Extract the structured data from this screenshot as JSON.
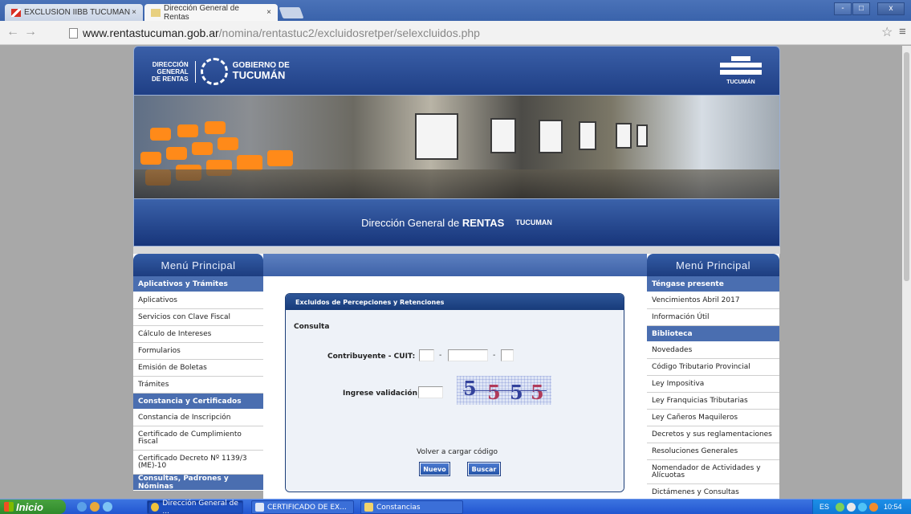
{
  "browser": {
    "tabs": [
      {
        "title": "EXCLUSION IIBB TUCUMAN",
        "icon": "gmail-icon"
      },
      {
        "title": "Dirección General de Rentas",
        "icon": "site-favicon-icon"
      }
    ],
    "close_glyph": "×",
    "url_host": "www.rentastucuman.gob.ar",
    "url_path": "/nomina/rentastuc2/excluidosretper/selexcluidos.php",
    "window_controls": [
      "-",
      "□",
      "x"
    ],
    "colors": {
      "tabbar": "#3a63ab"
    }
  },
  "header": {
    "logo_left": [
      "DIRECCIÓN",
      "GENERAL",
      "DE RENTAS"
    ],
    "logo_gob_1": "GOBIERNO DE",
    "logo_gob_2": "TUCUMÁN",
    "logo_right": "TUCUMÁN"
  },
  "titlebar": {
    "prefix": "Dirección General de ",
    "strong": "RENTAS",
    "suffix": "TUCUMAN"
  },
  "left_menu": {
    "title": "Menú Principal",
    "sections": [
      {
        "label": "Aplicativos y Trámites",
        "items": [
          "Aplicativos",
          "Servicios con Clave Fiscal",
          "Cálculo de Intereses",
          "Formularios",
          "Emisión de Boletas",
          "Trámites"
        ]
      },
      {
        "label": "Constancia y Certificados",
        "items": [
          "Constancia de Inscripción",
          "Certificado de Cumplimiento Fiscal",
          "Certificado Decreto Nº 1139/3 (ME)-10"
        ]
      },
      {
        "label": "Consultas, Padrones y Nóminas",
        "items": []
      }
    ]
  },
  "right_menu": {
    "title": "Menú Principal",
    "sections": [
      {
        "label": "Téngase presente",
        "items": [
          "Vencimientos Abril 2017",
          "Información Útil"
        ]
      },
      {
        "label": "Biblioteca",
        "items": [
          "Novedades",
          "Código Tributario Provincial",
          "Ley Impositiva",
          "Ley Franquicias Tributarias",
          "Ley Cañeros Maquileros",
          "Decretos y sus reglamentaciones",
          "Resoluciones Generales",
          "Nomendador de Actividades y Alícuotas",
          "Dictámenes y Consultas"
        ]
      }
    ]
  },
  "form": {
    "panel_title": "Excluidos de Percepciones y Retenciones",
    "section": "Consulta",
    "cuit_label": "Contribuyente - CUIT:",
    "cuit_values": [
      "",
      "",
      ""
    ],
    "separator": "-",
    "validation_label": "Ingrese validación",
    "validation_value": "",
    "captcha_text": [
      "5",
      "5",
      "5",
      "5"
    ],
    "reload_text": "Volver a cargar código",
    "btn_new": "Nuevo",
    "btn_search": "Buscar",
    "colors": {
      "accent": "#2454a8",
      "captcha_ink": "#33429c",
      "captcha_alt": "#b03a5a"
    }
  },
  "taskbar": {
    "start": "Inicio",
    "tasks": [
      "Dirección General de ...",
      "CERTIFICADO DE EX...",
      "Constancias"
    ],
    "lang": "ES",
    "time": "10:54"
  }
}
